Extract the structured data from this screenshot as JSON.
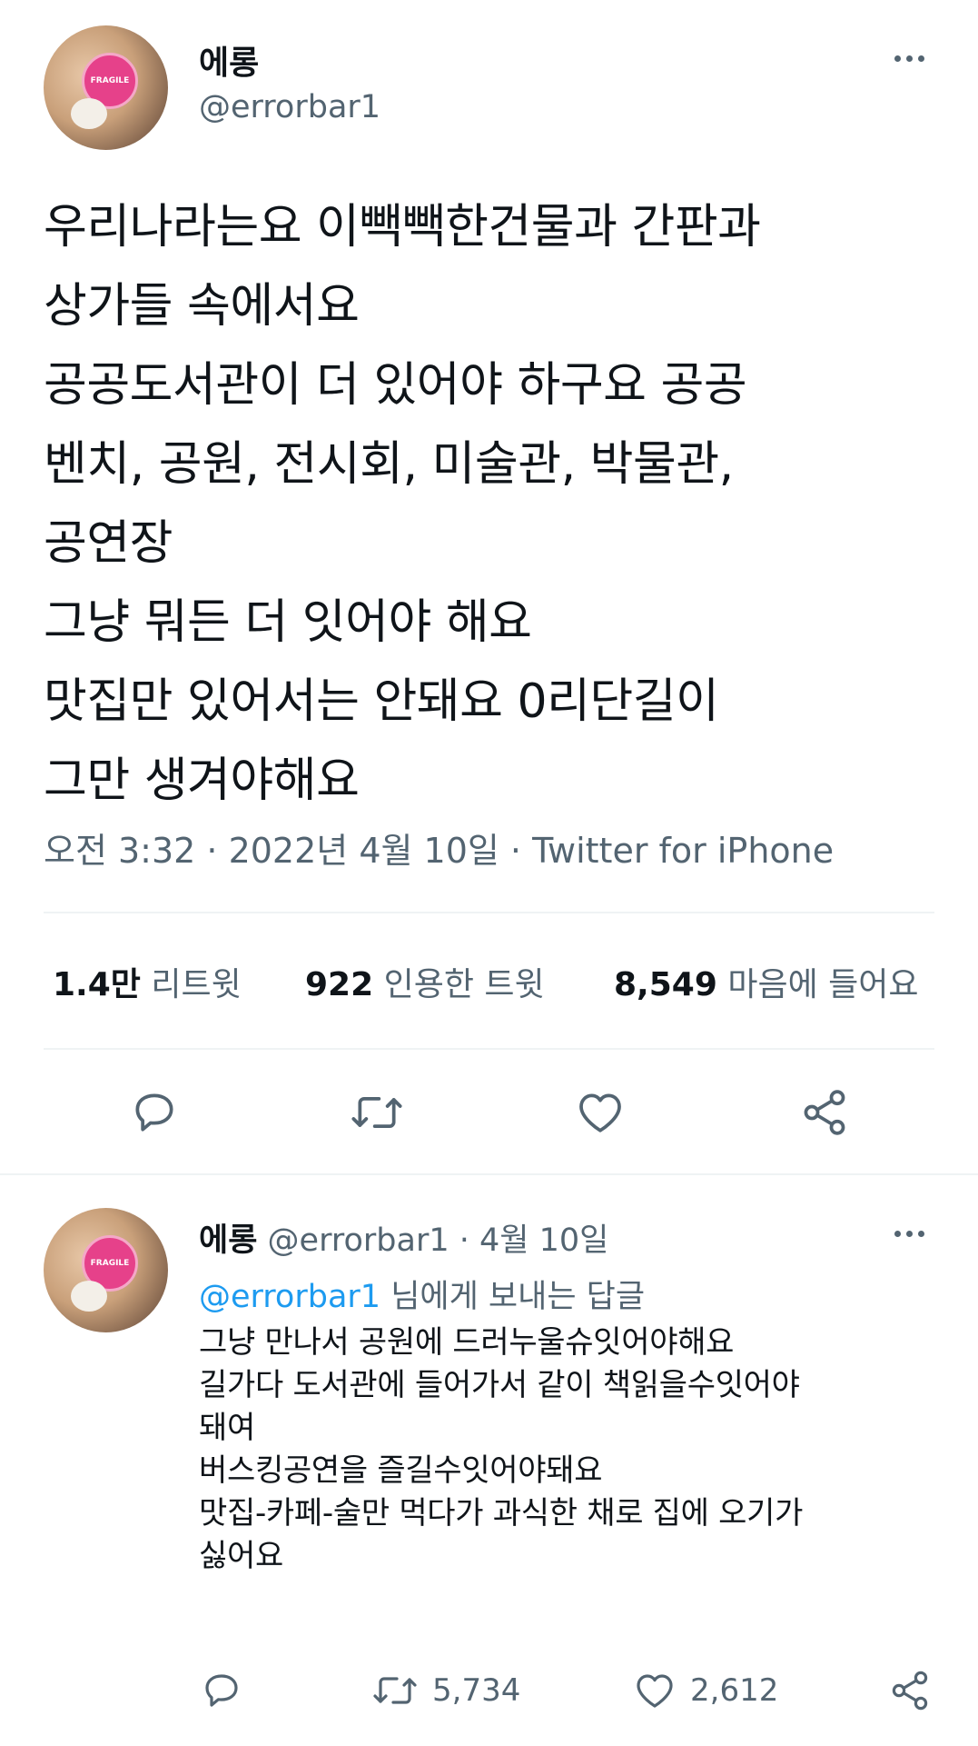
{
  "main_tweet": {
    "display_name": "에롱",
    "handle": "@errorbar1",
    "text_lines": [
      "우리나라는요 이빽빽한건물과 간판과",
      "상가들 속에서요",
      "공공도서관이 더 있어야 하구요 공공",
      "벤치, 공원, 전시회, 미술관, 박물관,",
      "공연장",
      "그냥 뭐든 더 잇어야 해요",
      "맛집만 있어서는 안돼요 0리단길이",
      "그만 생겨야해요"
    ],
    "meta": "오전 3:32 · 2022년 4월 10일 · Twitter for iPhone",
    "stats": [
      {
        "count": "1.4만",
        "label": "리트윗"
      },
      {
        "count": "922",
        "label": "인용한 트윗"
      },
      {
        "count": "8,549",
        "label": "마음에 들어요"
      }
    ]
  },
  "reply": {
    "display_name": "에롱",
    "handle": "@errorbar1",
    "separator": "·",
    "date": "4월 10일",
    "replying_to_handle": "@errorbar1",
    "replying_to_suffix": "님에게 보내는 답글",
    "text_lines": [
      "그냥 만나서 공원에 드러누울슈잇어야해요",
      "길가다 도서관에 들어가서 같이 책읽을수잇어야",
      "돼여",
      "버스킹공연을 즐길수잇어야돼요",
      "맛집-카페-술만 먹다가 과식한 채로 집에 오기가",
      "싫어요"
    ],
    "retweet_count": "5,734",
    "like_count": "2,612"
  },
  "avatar_sticker_text": "FRAGILE",
  "icons": {
    "more": "more-icon",
    "reply": "reply-icon",
    "retweet": "retweet-icon",
    "like": "like-icon",
    "share": "share-icon"
  },
  "colors": {
    "text": "#0f1419",
    "secondary": "#536471",
    "link": "#1d9bf0",
    "divider": "#eff3f4"
  }
}
